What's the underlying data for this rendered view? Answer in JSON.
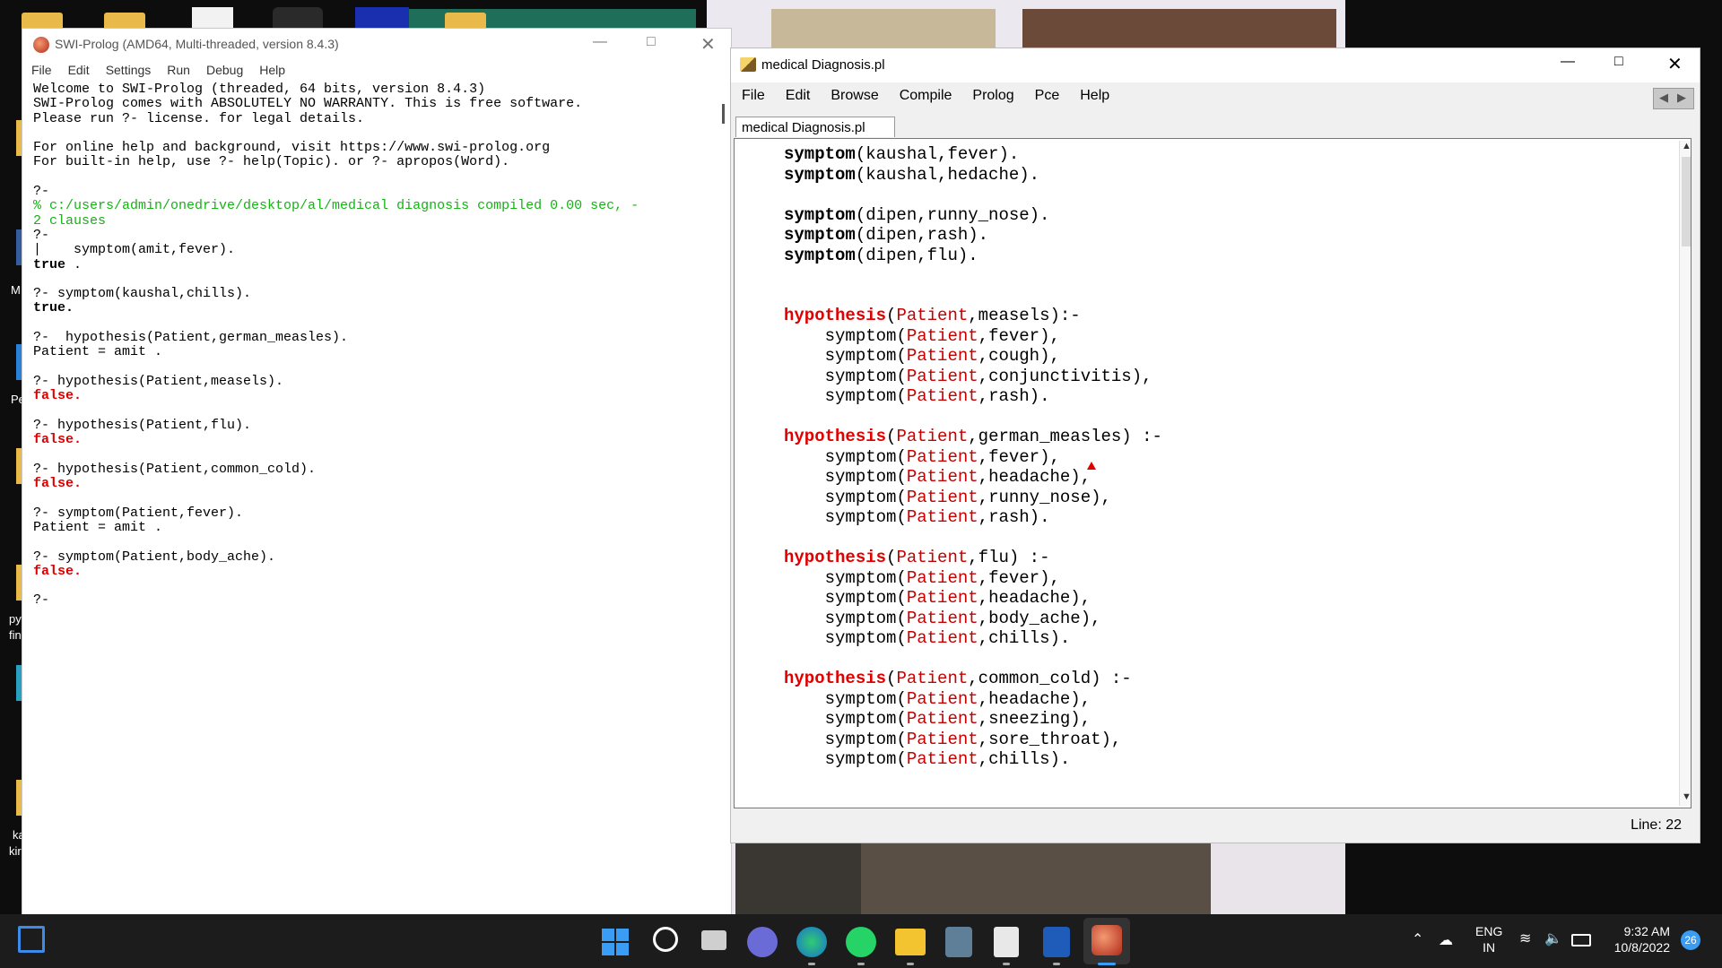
{
  "desktop": {
    "left_labels": [
      "M",
      "Pe",
      "py",
      "fin",
      "ka",
      "kir"
    ]
  },
  "swi": {
    "title": "SWI-Prolog (AMD64, Multi-threaded, version 8.4.3)",
    "menu": [
      "File",
      "Edit",
      "Settings",
      "Run",
      "Debug",
      "Help"
    ],
    "console": {
      "l1": "Welcome to SWI-Prolog (threaded, 64 bits, version 8.4.3)",
      "l2": "SWI-Prolog comes with ABSOLUTELY NO WARRANTY. This is free software.",
      "l3": "Please run ?- license. for legal details.",
      "l4": "For online help and background, visit https://www.swi-prolog.org",
      "l5": "For built-in help, use ?- help(Topic). or ?- apropos(Word).",
      "p1": "?-",
      "compiled1": "% c:/users/admin/onedrive/desktop/al/medical diagnosis compiled 0.00 sec, -",
      "compiled2": "2 clauses",
      "p2": "?-",
      "q1": "|    symptom(amit,fever).",
      "r1": "true",
      "r1b": " .",
      "q2": "?- symptom(kaushal,chills).",
      "r2": "true.",
      "q3": "?-  hypothesis(Patient,german_measles).",
      "r3": "Patient = amit .",
      "q4": "?- hypothesis(Patient,measels).",
      "r4": "false.",
      "q5": "?- hypothesis(Patient,flu).",
      "r5": "false.",
      "q6": "?- hypothesis(Patient,common_cold).",
      "r6": "false.",
      "q7": "?- symptom(Patient,fever).",
      "r7": "Patient = amit .",
      "q8": "?- symptom(Patient,body_ache).",
      "r8": "false.",
      "p3": "?-"
    }
  },
  "editor": {
    "title": "medical Diagnosis.pl",
    "menu": [
      "File",
      "Edit",
      "Browse",
      "Compile",
      "Prolog",
      "Pce",
      "Help"
    ],
    "tab": "medical Diagnosis.pl",
    "status": "Line: 22",
    "code": {
      "s1_f": "symptom",
      "s1_a": "(kaushal,fever).",
      "s2_f": "symptom",
      "s2_a": "(kaushal,hedache).",
      "s3_f": "symptom",
      "s3_a": "(dipen,runny_nose).",
      "s4_f": "symptom",
      "s4_a": "(dipen,rash).",
      "s5_f": "symptom",
      "s5_a": "(dipen,flu).",
      "h": "hypothesis",
      "sym": "symptom",
      "pat": "Patient",
      "h1_head": "measels):-",
      "h1_b": [
        "fever),",
        "cough),",
        "conjunctivitis),",
        "rash)."
      ],
      "h2_head": "german_measles) :-",
      "h2_b": [
        "fever),",
        "headache),",
        "runny_nose),",
        "rash)."
      ],
      "h3_head": "flu) :-",
      "h3_b": [
        "fever),",
        "headache),",
        "body_ache),",
        "chills)."
      ],
      "h4_head": "common_cold) :-",
      "h4_b": [
        "headache),",
        "sneezing),",
        "sore_throat),",
        "chills)."
      ]
    }
  },
  "taskbar": {
    "lang1": "ENG",
    "lang2": "IN",
    "time": "9:32 AM",
    "date": "10/8/2022",
    "badge": "26"
  }
}
